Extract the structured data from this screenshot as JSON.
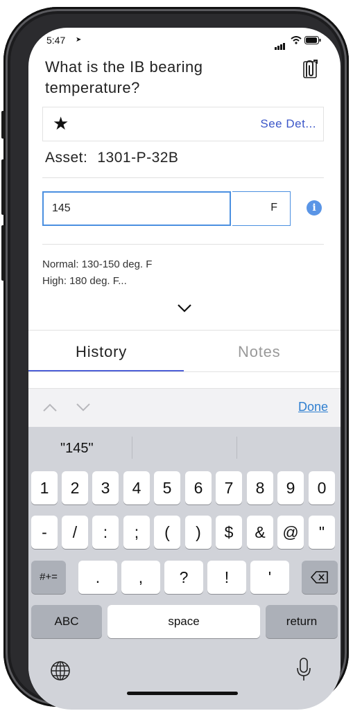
{
  "status_bar": {
    "time": "5:47"
  },
  "question": {
    "text": "What is the IB bearing temperature?"
  },
  "details": {
    "star": "★",
    "see_details": "See Det..."
  },
  "asset": {
    "label": "Asset:",
    "value": "1301-P-32B"
  },
  "reading": {
    "value": "145",
    "unit": "F",
    "info": "i"
  },
  "limits": {
    "normal": "Normal: 130-150 deg. F",
    "high": "High: 180 deg. F..."
  },
  "tabs": [
    {
      "label": "History",
      "active": true
    },
    {
      "label": "Notes",
      "active": false
    }
  ],
  "keyboard_toolbar": {
    "done": "Done"
  },
  "prediction": {
    "word": "\"145\""
  },
  "keyboard": {
    "row1": [
      "1",
      "2",
      "3",
      "4",
      "5",
      "6",
      "7",
      "8",
      "9",
      "0"
    ],
    "row2": [
      "-",
      "/",
      ":",
      ";",
      "(",
      ")",
      "$",
      "&",
      "@",
      "\""
    ],
    "row3": [
      ".",
      ",",
      "?",
      "!",
      "'"
    ],
    "more_symbols": "#+=",
    "abc": "ABC",
    "space": "space",
    "return": "return"
  },
  "colors": {
    "accent": "#4d5fd8",
    "link": "#3b56c8",
    "input_border": "#4a8fe0",
    "keyboard_bg": "#d1d3d9"
  }
}
